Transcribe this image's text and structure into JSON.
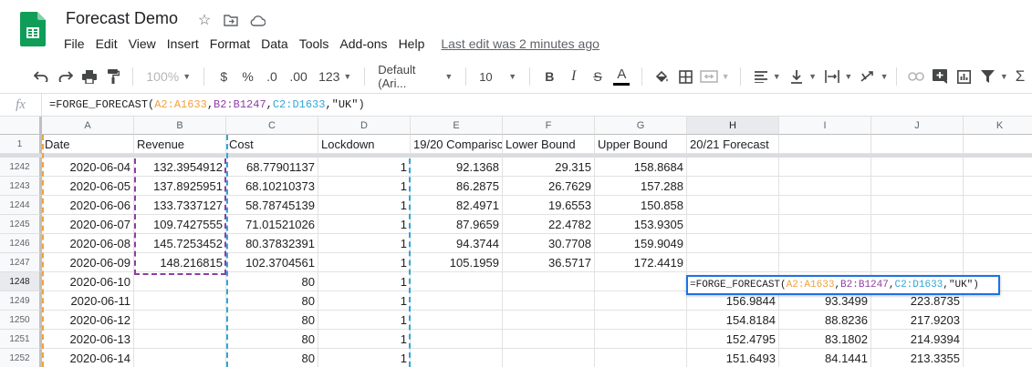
{
  "doc": {
    "title": "Forecast Demo",
    "last_edit": "Last edit was 2 minutes ago"
  },
  "menu": [
    "File",
    "Edit",
    "View",
    "Insert",
    "Format",
    "Data",
    "Tools",
    "Add-ons",
    "Help"
  ],
  "toolbar": {
    "zoom": "100%",
    "currency": "$",
    "percent": "%",
    "dec_decrease": ".0",
    "dec_increase": ".00",
    "more_formats": "123",
    "font": "Default (Ari...",
    "font_size": "10",
    "bold": "B",
    "italic": "I",
    "strike": "S",
    "text_color": "A"
  },
  "formula_bar": {
    "fx": "fx",
    "formula": {
      "prefix": "=FORGE_FORECAST(",
      "ref_a": "A2:A1633",
      "sep1": ",",
      "ref_b": "B2:B1247",
      "sep2": ",",
      "ref_c": "C2:D1633",
      "suffix": ",\"UK\")"
    }
  },
  "columns": [
    "A",
    "B",
    "C",
    "D",
    "E",
    "F",
    "G",
    "H",
    "I",
    "J",
    "K"
  ],
  "header_row": {
    "rownum": "1",
    "cells": [
      "Date",
      "Revenue",
      "Cost",
      "Lockdown",
      "19/20 Comparisc",
      "Lower Bound",
      "Upper Bound",
      "20/21 Forecast",
      "",
      "",
      ""
    ]
  },
  "rows": [
    {
      "rownum": "1242",
      "cells": [
        "2020-06-04",
        "132.3954912",
        "68.77901137",
        "1",
        "92.1368",
        "29.315",
        "158.8684",
        "",
        "",
        "",
        ""
      ]
    },
    {
      "rownum": "1243",
      "cells": [
        "2020-06-05",
        "137.8925951",
        "68.10210373",
        "1",
        "86.2875",
        "26.7629",
        "157.288",
        "",
        "",
        "",
        ""
      ]
    },
    {
      "rownum": "1244",
      "cells": [
        "2020-06-06",
        "133.7337127",
        "58.78745139",
        "1",
        "82.4971",
        "19.6553",
        "150.858",
        "",
        "",
        "",
        ""
      ]
    },
    {
      "rownum": "1245",
      "cells": [
        "2020-06-07",
        "109.7427555",
        "71.01521026",
        "1",
        "87.9659",
        "22.4782",
        "153.9305",
        "",
        "",
        "",
        ""
      ]
    },
    {
      "rownum": "1246",
      "cells": [
        "2020-06-08",
        "145.7253452",
        "80.37832391",
        "1",
        "94.3744",
        "30.7708",
        "159.9049",
        "",
        "",
        "",
        ""
      ]
    },
    {
      "rownum": "1247",
      "cells": [
        "2020-06-09",
        "148.216815",
        "102.3704561",
        "1",
        "105.1959",
        "36.5717",
        "172.4419",
        "",
        "",
        "",
        ""
      ]
    },
    {
      "rownum": "1248",
      "cells": [
        "2020-06-10",
        "",
        "80",
        "1",
        "",
        "",
        "",
        "",
        "",
        "",
        ""
      ]
    },
    {
      "rownum": "1249",
      "cells": [
        "2020-06-11",
        "",
        "80",
        "1",
        "",
        "",
        "",
        "156.9844",
        "93.3499",
        "223.8735",
        ""
      ]
    },
    {
      "rownum": "1250",
      "cells": [
        "2020-06-12",
        "",
        "80",
        "1",
        "",
        "",
        "",
        "154.8184",
        "88.8236",
        "217.9203",
        ""
      ]
    },
    {
      "rownum": "1251",
      "cells": [
        "2020-06-13",
        "",
        "80",
        "1",
        "",
        "",
        "",
        "152.4795",
        "83.1802",
        "214.9394",
        ""
      ]
    },
    {
      "rownum": "1252",
      "cells": [
        "2020-06-14",
        "",
        "80",
        "1",
        "",
        "",
        "",
        "151.6493",
        "84.1441",
        "213.3355",
        ""
      ]
    }
  ],
  "colors": {
    "ref_a": "#f0a23b",
    "ref_b": "#8e3da3",
    "ref_c": "#2ea7d8",
    "selection": "#1a73e8",
    "logo": "#0f9d58"
  }
}
